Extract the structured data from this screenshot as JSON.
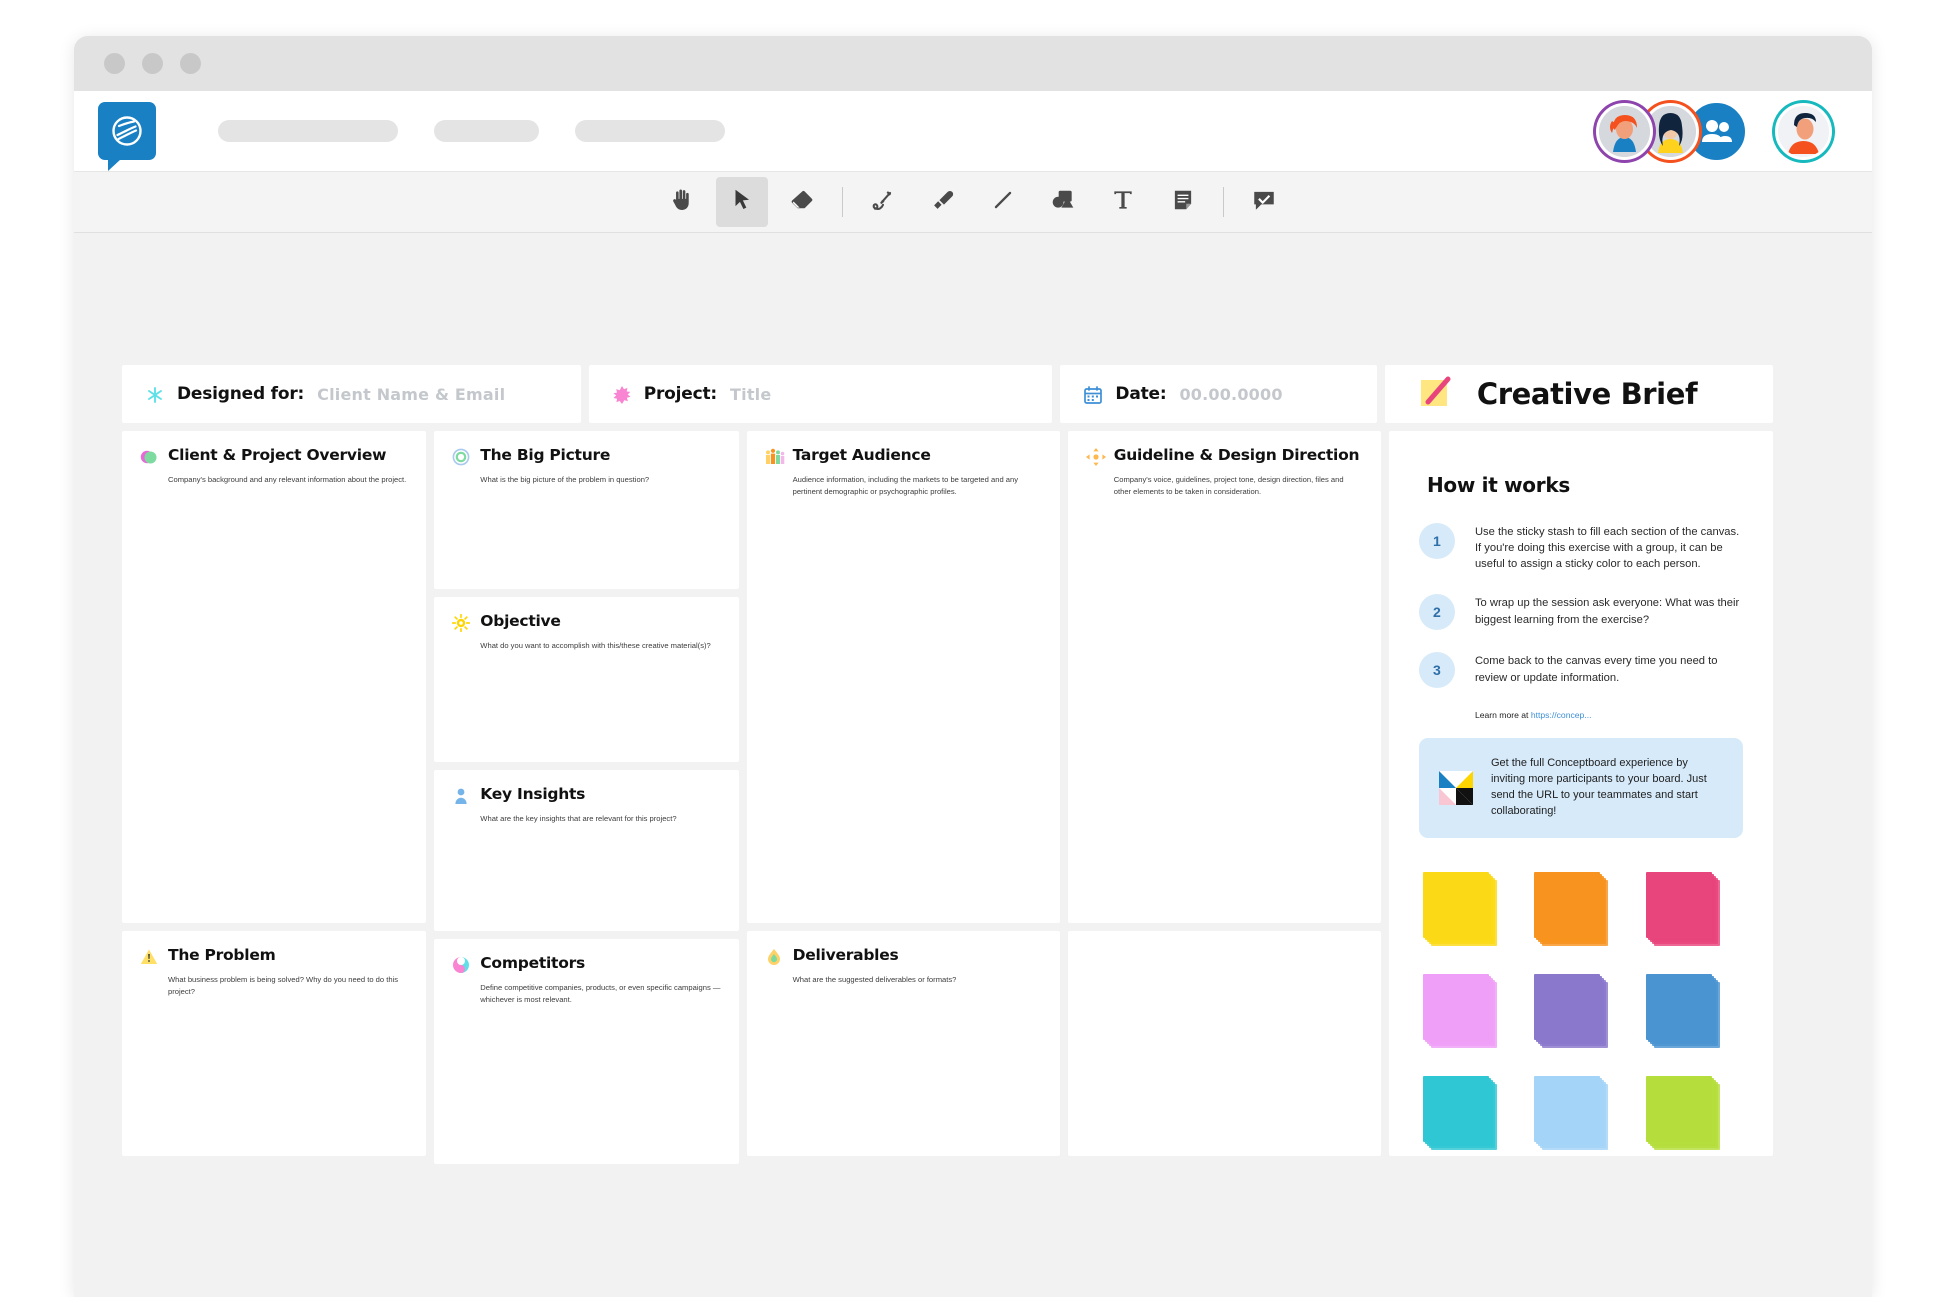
{
  "window": {
    "dots": 3
  },
  "header": {
    "logo_icon": "conceptboard-logo-icon",
    "nav_pill_count": 3,
    "avatars": [
      "avatar-user-1",
      "avatar-user-2",
      "avatar-group",
      "avatar-current-user"
    ]
  },
  "toolbar": {
    "tools": [
      {
        "name": "hand-tool",
        "icon": "hand-icon",
        "active": false
      },
      {
        "name": "select-tool",
        "icon": "cursor-arrow-icon",
        "active": true
      },
      {
        "name": "eraser-tool",
        "icon": "eraser-icon",
        "active": false
      },
      {
        "name": "pen-tool",
        "icon": "pen-icon",
        "active": false
      },
      {
        "name": "highlighter-tool",
        "icon": "highlighter-icon",
        "active": false
      },
      {
        "name": "line-tool",
        "icon": "line-icon",
        "active": false
      },
      {
        "name": "shapes-tool",
        "icon": "shapes-icon",
        "active": false
      },
      {
        "name": "text-tool",
        "icon": "text-t-icon",
        "active": false
      },
      {
        "name": "note-tool",
        "icon": "sticky-note-icon",
        "active": false
      },
      {
        "name": "comment-tool",
        "icon": "comment-check-icon",
        "active": false
      }
    ]
  },
  "board": {
    "header_fields": [
      {
        "icon": "asterisk-icon",
        "label": "Designed for:",
        "value": "Client Name & Email"
      },
      {
        "icon": "star-burst-icon",
        "label": "Project:",
        "value": "Title"
      },
      {
        "icon": "calendar-icon",
        "label": "Date:",
        "value": "00.00.0000"
      }
    ],
    "brief_title": "Creative Brief",
    "brief_icon": "pencil-note-icon",
    "cards": [
      {
        "id": "client-project-overview",
        "icon": "circle-duo-icon",
        "title": "Client & Project Overview",
        "subtitle": "Company's background and any relevant information about the project."
      },
      {
        "id": "the-big-picture",
        "icon": "target-ring-icon",
        "title": "The Big Picture",
        "subtitle": "What is the big picture of the problem in question?"
      },
      {
        "id": "objective",
        "icon": "sun-icon",
        "title": "Objective",
        "subtitle": "What do you want to accomplish with this/these creative material(s)?"
      },
      {
        "id": "key-insights",
        "icon": "person-icon",
        "title": "Key Insights",
        "subtitle": "What are the key insights that are relevant for this project?"
      },
      {
        "id": "target-audience",
        "icon": "people-bars-icon",
        "title": "Target Audience",
        "subtitle": "Audience information, including the markets to be targeted and any pertinent demographic or psychographic profiles."
      },
      {
        "id": "guideline-design-direction",
        "icon": "move-arrows-icon",
        "title": "Guideline & Design Direction",
        "subtitle": "Company's voice, guidelines, project tone, design direction, files and other elements to be taken in consideration."
      },
      {
        "id": "the-problem",
        "icon": "warning-icon",
        "title": "The Problem",
        "subtitle": "What business problem is being solved? Why do you need to do this project?"
      },
      {
        "id": "competitors",
        "icon": "yin-yang-icon",
        "title": "Competitors",
        "subtitle": "Define competitive companies, products, or even specific campaigns — whichever is most relevant."
      },
      {
        "id": "deliverables",
        "icon": "drop-icon",
        "title": "Deliverables",
        "subtitle": "What are the suggested deliverables or formats?"
      }
    ]
  },
  "panel": {
    "heading": "How it works",
    "steps": [
      {
        "number": "1",
        "text": "Use the sticky stash to fill each section of the canvas. If you're doing this exercise with a group, it can be useful to assign a sticky color to each person."
      },
      {
        "number": "2",
        "text": "To wrap up the session ask everyone: What was their biggest learning from the exercise?"
      },
      {
        "number": "3",
        "text": "Come back to the canvas every time you need to review or update information."
      }
    ],
    "learn_more_prefix": "Learn more at ",
    "learn_more_link": "https://concep...",
    "promo_icon": "conceptboard-mark-icon",
    "promo_text": "Get the full Conceptboard experience by inviting more participants to your board. Just send the URL to your teammates and start collaborating!",
    "sticky_colors": [
      "#fbd916",
      "#f7931e",
      "#e8457c",
      "#ef9ff7",
      "#8a78cc",
      "#4a94d1",
      "#2fc7d4",
      "#a4d4f7",
      "#b5de3c"
    ]
  },
  "colors": {
    "accent": "#1a80c4",
    "highlight": "#ffe680",
    "panel_blue": "#d6eaf9"
  }
}
